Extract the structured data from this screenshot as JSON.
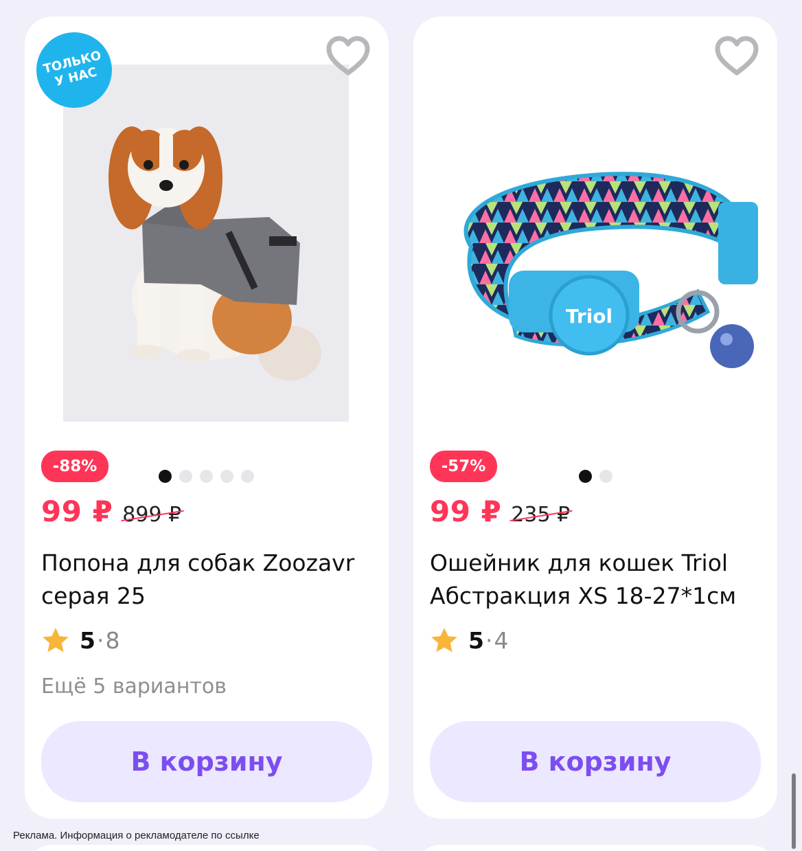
{
  "products": [
    {
      "exclusive_badge": {
        "line1": "Только",
        "line2": "у нас"
      },
      "discount": "-88%",
      "image_dots": {
        "total": 5,
        "active": 0
      },
      "price_now": "99 ₽",
      "price_old": "899 ₽",
      "title": "Попона для собак Zoozavr серая 25",
      "rating": {
        "score": "5",
        "separator": "·",
        "count": "8"
      },
      "variants": "Ещё 5 вариантов",
      "cart_label": "В корзину"
    },
    {
      "discount": "-57%",
      "image_dots": {
        "total": 2,
        "active": 0
      },
      "price_now": "99 ₽",
      "price_old": "235 ₽",
      "title": "Ошейник для кошек Triol Абстракция XS 18-27*1см",
      "brand_on_buckle": "Triol",
      "rating": {
        "score": "5",
        "separator": "·",
        "count": "4"
      },
      "cart_label": "В корзину"
    }
  ],
  "ad_note": "Реклама. Информация о рекламодателе по ссылке",
  "icons": {
    "favorite": "heart-outline-icon",
    "rating": "star-icon"
  },
  "colors": {
    "price_accent": "#ff3558",
    "cart_button_bg": "#ece8ff",
    "cart_button_text": "#7b4ef0",
    "exclusive_badge": "#1fb5ec",
    "page_bg": "#f0effa"
  }
}
